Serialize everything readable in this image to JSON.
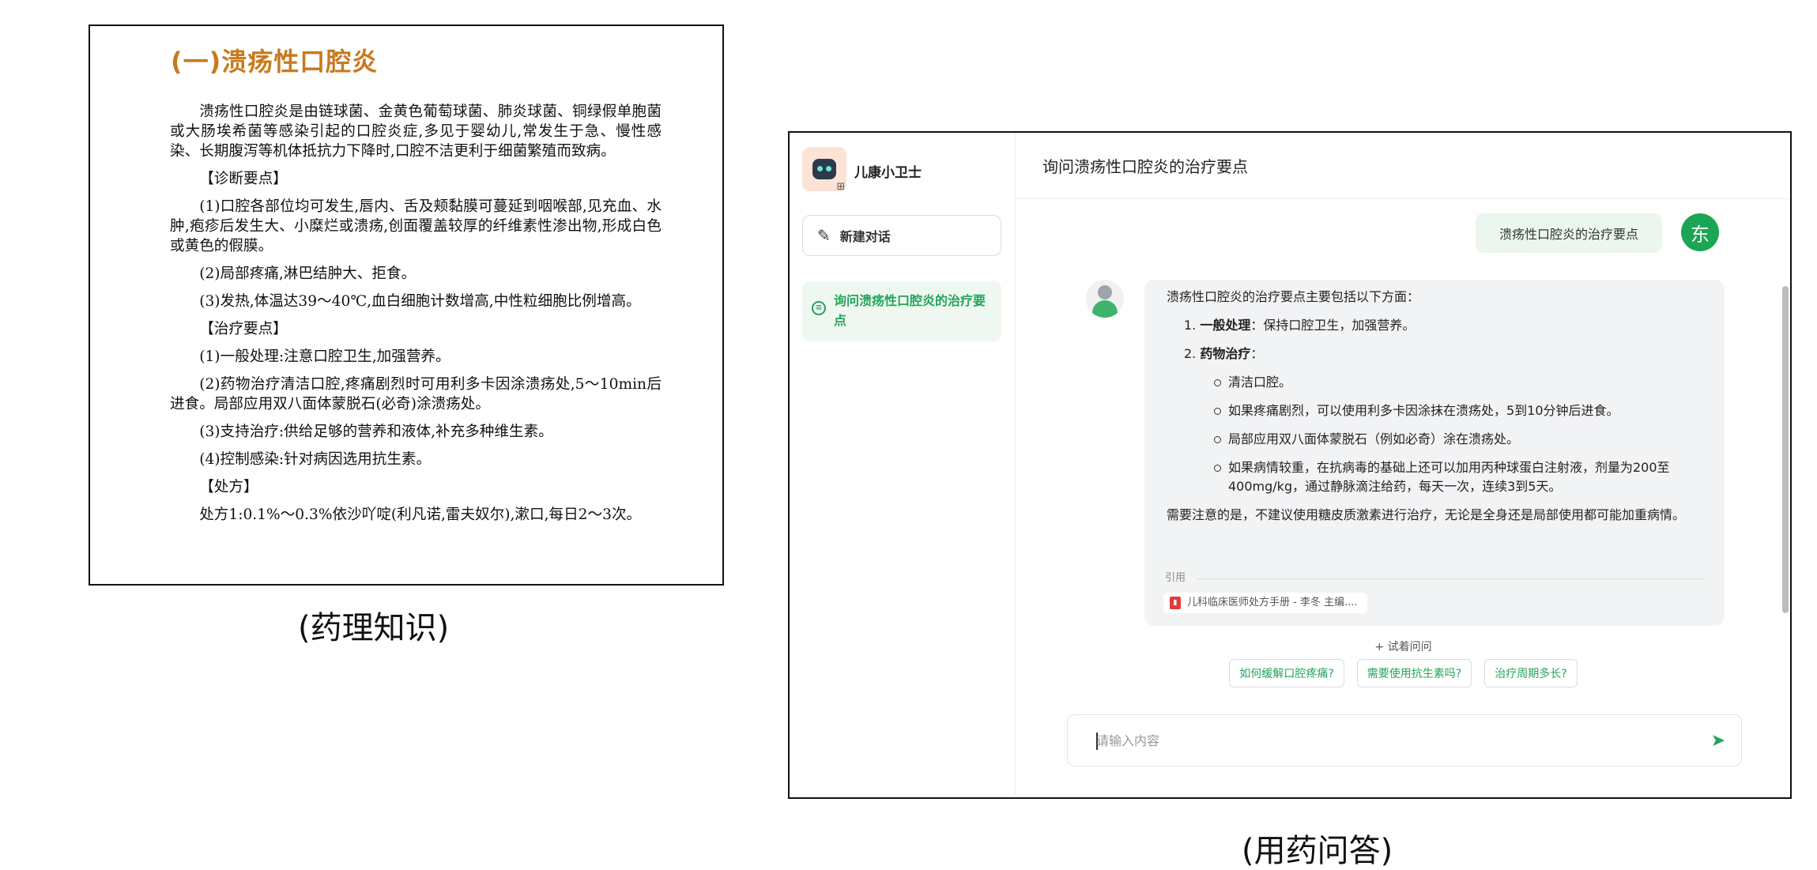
{
  "document": {
    "title": "(一)溃疡性口腔炎",
    "paragraphs": [
      "溃疡性口腔炎是由链球菌、金黄色葡萄球菌、肺炎球菌、铜绿假单胞菌或大肠埃希菌等感染引起的口腔炎症,多见于婴幼儿,常发生于急、慢性感染、长期腹泻等机体抵抗力下降时,口腔不洁更利于细菌繁殖而致病。",
      "【诊断要点】",
      "(1)口腔各部位均可发生,唇内、舌及颊黏膜可蔓延到咽喉部,见充血、水肿,疱疹后发生大、小糜烂或溃疡,创面覆盖较厚的纤维素性渗出物,形成白色或黄色的假膜。",
      "(2)局部疼痛,淋巴结肿大、拒食。",
      "(3)发热,体温达39～40℃,血白细胞计数增高,中性粒细胞比例增高。",
      "【治疗要点】",
      "(1)一般处理:注意口腔卫生,加强营养。",
      "(2)药物治疗清洁口腔,疼痛剧烈时可用利多卡因涂溃疡处,5～10min后进食。局部应用双八面体蒙脱石(必奇)涂溃疡处。",
      "(3)支持治疗:供给足够的营养和液体,补充多种维生素。",
      "(4)控制感染:针对病因选用抗生素。",
      "【处方】",
      "处方1:0.1%～0.3%依沙吖啶(利凡诺,雷夫奴尔),漱口,每日2～3次。"
    ]
  },
  "captions": {
    "left": "(药理知识)",
    "right": "(用药问答)"
  },
  "app": {
    "brand_name": "儿康小卫士",
    "new_chat_label": "新建对话",
    "history": [
      "询问溃疡性口腔炎的治疗要点"
    ],
    "header_title": "询问溃疡性口腔炎的治疗要点",
    "user_avatar_text": "东",
    "user_message": "溃疡性口腔炎的治疗要点",
    "answer": {
      "intro": "溃疡性口腔炎的治疗要点主要包括以下方面：",
      "item1_num": "1.",
      "item1_bold": "一般处理",
      "item1_text": "：保持口腔卫生，加强营养。",
      "item2_num": "2.",
      "item2_bold": "药物治疗",
      "item2_text": "：",
      "bullets": [
        "清洁口腔。",
        "如果疼痛剧烈，可以使用利多卡因涂抹在溃疡处，5到10分钟后进食。",
        "局部应用双八面体蒙脱石（例如必奇）涂在溃疡处。",
        "如果病情较重，在抗病毒的基础上还可以加用丙种球蛋白注射液，剂量为200至400mg/kg，通过静脉滴注给药，每天一次，连续3到5天。"
      ],
      "note": "需要注意的是，不建议使用糖皮质激素进行治疗，无论是全身还是局部使用都可能加重病情。",
      "citation_label": "引用",
      "citation": "儿科临床医师处方手册 - 李冬 主编...."
    },
    "try_ask_label": "+ 试着问问",
    "suggestions": [
      "如何缓解口腔疼痛?",
      "需要使用抗生素吗?",
      "治疗周期多长?"
    ],
    "input_placeholder": "请输入内容",
    "colors": {
      "accent": "#25a35a",
      "title_orange": "#c87a1d"
    },
    "icons": [
      "robot-logo-icon",
      "grid-icon",
      "pencil-icon",
      "chat-bubble-icon",
      "pdf-icon",
      "send-icon"
    ]
  }
}
